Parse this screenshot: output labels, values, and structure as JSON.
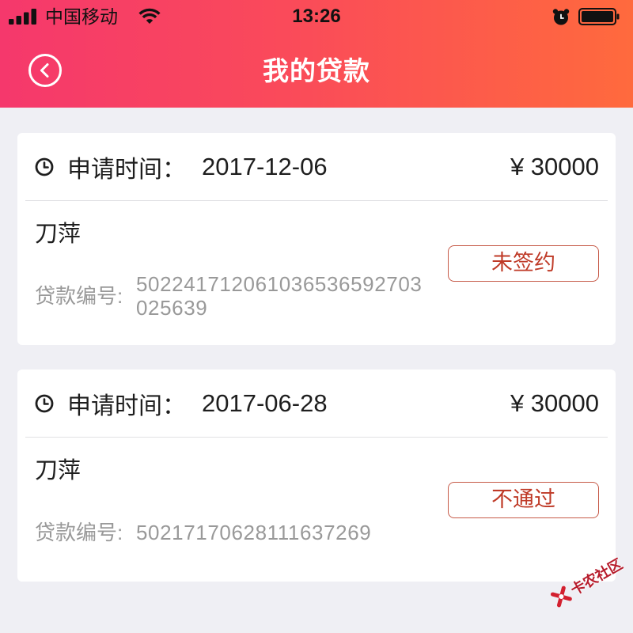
{
  "status_bar": {
    "carrier": "中国移动",
    "time": "13:26"
  },
  "nav": {
    "title": "我的贷款"
  },
  "loans": [
    {
      "apply_label": "申请时间：",
      "apply_date": "2017-12-06",
      "amount": "¥ 30000",
      "name": "刀萍",
      "number_label": "贷款编号:",
      "number": "502241712061036536592703025639",
      "status": "未签约"
    },
    {
      "apply_label": "申请时间：",
      "apply_date": "2017-06-28",
      "amount": "¥ 30000",
      "name": "刀萍",
      "number_label": "贷款编号:",
      "number": "50217170628111637269",
      "status": "不通过"
    }
  ],
  "watermark": {
    "text": "卡农社区"
  },
  "icons": {
    "signal": "cellular-signal-icon",
    "wifi": "wifi-icon",
    "alarm": "alarm-clock-icon",
    "battery": "battery-icon",
    "back": "back-circle-icon",
    "apply_time": "clock-icon",
    "watermark_logo": "kanong-logo-icon"
  },
  "theme": {
    "header_gradient_start": "#f5386c",
    "header_gradient_end": "#ff6a3d",
    "page_background": "#efeff4",
    "status_accent": "#bf3a27",
    "status_border": "#c65a48",
    "text_main": "#1e1e1e",
    "text_secondary": "#999999",
    "status_bar_text": "#111111",
    "watermark_color": "#b71c2c"
  }
}
